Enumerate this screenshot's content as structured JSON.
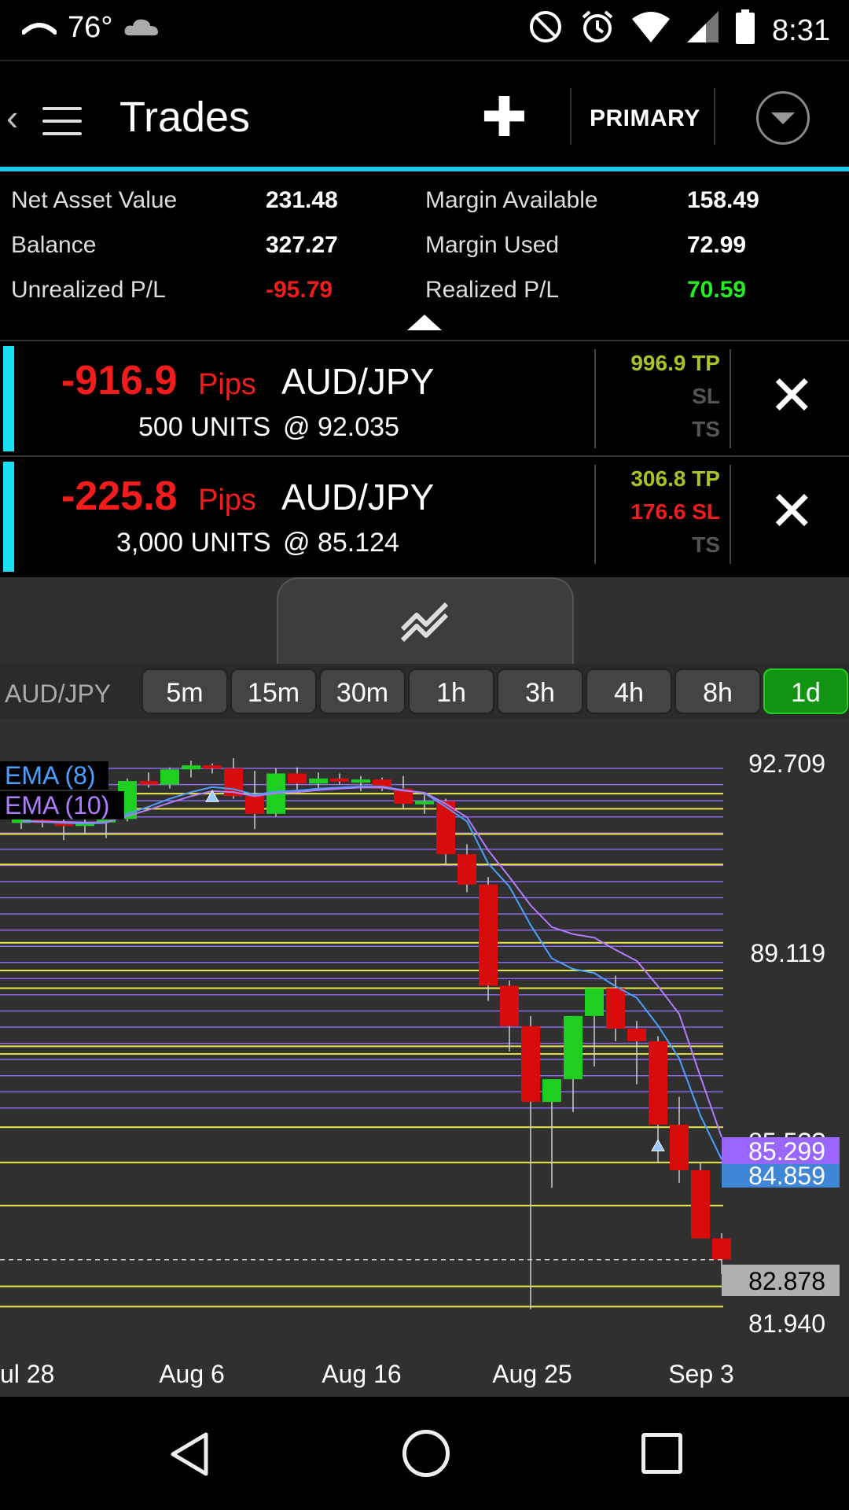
{
  "status_bar": {
    "temperature": "76°",
    "time": "8:31",
    "icons": [
      "signal-arc-icon",
      "cloud-icon",
      "do-not-disturb-icon",
      "alarm-icon",
      "wifi-icon",
      "cell-signal-icon",
      "battery-icon"
    ]
  },
  "app_bar": {
    "title": "Trades",
    "account": "PRIMARY",
    "icons": [
      "back-chevron-icon",
      "menu-icon",
      "plus-icon",
      "dropdown-circle-icon"
    ]
  },
  "summary": {
    "rows": [
      {
        "label1": "Net Asset Value",
        "value1": "231.48",
        "label2": "Margin Available",
        "value2": "158.49"
      },
      {
        "label1": "Balance",
        "value1": "327.27",
        "label2": "Margin Used",
        "value2": "72.99"
      },
      {
        "label1": "Unrealized P/L",
        "value1": "-95.79",
        "label2": "Realized P/L",
        "value2": "70.59"
      }
    ]
  },
  "trades": [
    {
      "pips": "-916.9",
      "pips_label": "Pips",
      "pair": "AUD/JPY",
      "units": "500 UNITS",
      "price": "@ 92.035",
      "tp": "996.9 TP",
      "sl": "SL",
      "ts": "TS",
      "sl_active": false
    },
    {
      "pips": "-225.8",
      "pips_label": "Pips",
      "pair": "AUD/JPY",
      "units": "3,000 UNITS",
      "price": "@ 85.124",
      "tp": "306.8 TP",
      "sl": "176.6 SL",
      "ts": "TS",
      "sl_active": true
    }
  ],
  "timeframe_bar": {
    "pair": "AUD/JPY",
    "options": [
      "5m",
      "15m",
      "30m",
      "1h",
      "3h",
      "4h",
      "8h",
      "1d"
    ],
    "selected": "1d"
  },
  "chart_data": {
    "type": "candlestick",
    "pair": "AUD/JPY",
    "x_labels": [
      "ul 28",
      "Aug 6",
      "Aug 16",
      "Aug 25",
      "Sep 3"
    ],
    "y_ticks": [
      "92.709",
      "89.119",
      "81.940"
    ],
    "ylim": [
      81.5,
      93.5
    ],
    "legend": [
      "EMA (8)",
      "EMA (10)"
    ],
    "price_tags": [
      {
        "text": "85.299",
        "color": "#9966ff"
      },
      {
        "text": "84.859",
        "color": "#3f86d6"
      },
      {
        "text": "82.878",
        "color": "#b0b0b0"
      }
    ],
    "hidden_tag": "85.5??",
    "candles": [
      {
        "o": 91.52,
        "h": 91.75,
        "l": 91.4,
        "c": 91.6
      },
      {
        "o": 91.58,
        "h": 91.7,
        "l": 91.43,
        "c": 91.52
      },
      {
        "o": 91.52,
        "h": 91.75,
        "l": 91.18,
        "c": 91.46
      },
      {
        "o": 91.46,
        "h": 91.6,
        "l": 91.3,
        "c": 91.53
      },
      {
        "o": 91.53,
        "h": 91.82,
        "l": 91.22,
        "c": 91.6
      },
      {
        "o": 91.6,
        "h": 92.4,
        "l": 91.55,
        "c": 92.35
      },
      {
        "o": 92.35,
        "h": 92.52,
        "l": 92.22,
        "c": 92.28
      },
      {
        "o": 92.28,
        "h": 92.62,
        "l": 92.2,
        "c": 92.58
      },
      {
        "o": 92.58,
        "h": 92.75,
        "l": 92.42,
        "c": 92.66
      },
      {
        "o": 92.66,
        "h": 92.7,
        "l": 92.5,
        "c": 92.6
      },
      {
        "o": 92.6,
        "h": 92.8,
        "l": 92.0,
        "c": 92.05
      },
      {
        "o": 92.05,
        "h": 92.55,
        "l": 91.4,
        "c": 91.7
      },
      {
        "o": 91.7,
        "h": 92.6,
        "l": 91.65,
        "c": 92.5
      },
      {
        "o": 92.5,
        "h": 92.62,
        "l": 92.15,
        "c": 92.3
      },
      {
        "o": 92.3,
        "h": 92.52,
        "l": 92.2,
        "c": 92.4
      },
      {
        "o": 92.4,
        "h": 92.5,
        "l": 92.28,
        "c": 92.35
      },
      {
        "o": 92.35,
        "h": 92.45,
        "l": 92.15,
        "c": 92.38
      },
      {
        "o": 92.38,
        "h": 92.42,
        "l": 92.15,
        "c": 92.2
      },
      {
        "o": 92.2,
        "h": 92.45,
        "l": 91.8,
        "c": 91.9
      },
      {
        "o": 91.9,
        "h": 92.1,
        "l": 91.7,
        "c": 91.95
      },
      {
        "o": 91.95,
        "h": 92.0,
        "l": 90.7,
        "c": 90.9
      },
      {
        "o": 90.9,
        "h": 91.1,
        "l": 90.15,
        "c": 90.3
      },
      {
        "o": 90.3,
        "h": 90.45,
        "l": 88.0,
        "c": 88.3
      },
      {
        "o": 88.3,
        "h": 88.4,
        "l": 87.0,
        "c": 87.5
      },
      {
        "o": 87.5,
        "h": 87.7,
        "l": 81.9,
        "c": 86.0
      },
      {
        "o": 86.0,
        "h": 86.45,
        "l": 84.3,
        "c": 86.45
      },
      {
        "o": 86.45,
        "h": 87.7,
        "l": 85.8,
        "c": 87.7
      },
      {
        "o": 87.7,
        "h": 88.2,
        "l": 86.7,
        "c": 88.25
      },
      {
        "o": 88.25,
        "h": 88.5,
        "l": 87.2,
        "c": 87.45
      },
      {
        "o": 87.45,
        "h": 87.6,
        "l": 86.35,
        "c": 87.2
      },
      {
        "o": 87.2,
        "h": 87.3,
        "l": 84.8,
        "c": 85.55
      },
      {
        "o": 85.55,
        "h": 86.1,
        "l": 84.4,
        "c": 84.65
      },
      {
        "o": 84.65,
        "h": 84.8,
        "l": 83.4,
        "c": 83.3
      },
      {
        "o": 83.3,
        "h": 83.4,
        "l": 82.6,
        "c": 82.88
      }
    ],
    "ema8": [
      91.55,
      91.54,
      91.52,
      91.51,
      91.52,
      91.7,
      91.84,
      92.0,
      92.13,
      92.23,
      92.19,
      92.08,
      92.14,
      92.16,
      92.2,
      92.22,
      92.24,
      92.24,
      92.17,
      92.11,
      91.84,
      91.55,
      90.72,
      90.26,
      89.5,
      88.84,
      88.63,
      88.55,
      88.29,
      88.06,
      87.51,
      86.86,
      85.73,
      84.86
    ],
    "ema10": [
      91.56,
      91.55,
      91.54,
      91.53,
      91.53,
      91.66,
      91.78,
      91.92,
      92.05,
      92.15,
      92.13,
      92.05,
      92.11,
      92.13,
      92.17,
      92.2,
      92.22,
      92.22,
      92.16,
      92.12,
      91.9,
      91.63,
      90.98,
      90.45,
      89.89,
      89.46,
      89.32,
      89.25,
      89.01,
      88.79,
      88.29,
      87.74,
      86.5,
      85.3
    ]
  }
}
